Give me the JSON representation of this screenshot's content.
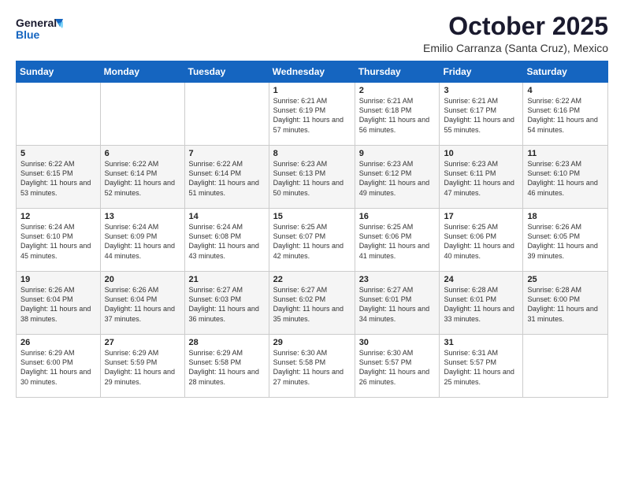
{
  "header": {
    "logo_line1": "General",
    "logo_line2": "Blue",
    "month_title": "October 2025",
    "subtitle": "Emilio Carranza (Santa Cruz), Mexico"
  },
  "weekdays": [
    "Sunday",
    "Monday",
    "Tuesday",
    "Wednesday",
    "Thursday",
    "Friday",
    "Saturday"
  ],
  "weeks": [
    [
      {
        "day": "",
        "sunrise": "",
        "sunset": "",
        "daylight": ""
      },
      {
        "day": "",
        "sunrise": "",
        "sunset": "",
        "daylight": ""
      },
      {
        "day": "",
        "sunrise": "",
        "sunset": "",
        "daylight": ""
      },
      {
        "day": "1",
        "sunrise": "Sunrise: 6:21 AM",
        "sunset": "Sunset: 6:19 PM",
        "daylight": "Daylight: 11 hours and 57 minutes."
      },
      {
        "day": "2",
        "sunrise": "Sunrise: 6:21 AM",
        "sunset": "Sunset: 6:18 PM",
        "daylight": "Daylight: 11 hours and 56 minutes."
      },
      {
        "day": "3",
        "sunrise": "Sunrise: 6:21 AM",
        "sunset": "Sunset: 6:17 PM",
        "daylight": "Daylight: 11 hours and 55 minutes."
      },
      {
        "day": "4",
        "sunrise": "Sunrise: 6:22 AM",
        "sunset": "Sunset: 6:16 PM",
        "daylight": "Daylight: 11 hours and 54 minutes."
      }
    ],
    [
      {
        "day": "5",
        "sunrise": "Sunrise: 6:22 AM",
        "sunset": "Sunset: 6:15 PM",
        "daylight": "Daylight: 11 hours and 53 minutes."
      },
      {
        "day": "6",
        "sunrise": "Sunrise: 6:22 AM",
        "sunset": "Sunset: 6:14 PM",
        "daylight": "Daylight: 11 hours and 52 minutes."
      },
      {
        "day": "7",
        "sunrise": "Sunrise: 6:22 AM",
        "sunset": "Sunset: 6:14 PM",
        "daylight": "Daylight: 11 hours and 51 minutes."
      },
      {
        "day": "8",
        "sunrise": "Sunrise: 6:23 AM",
        "sunset": "Sunset: 6:13 PM",
        "daylight": "Daylight: 11 hours and 50 minutes."
      },
      {
        "day": "9",
        "sunrise": "Sunrise: 6:23 AM",
        "sunset": "Sunset: 6:12 PM",
        "daylight": "Daylight: 11 hours and 49 minutes."
      },
      {
        "day": "10",
        "sunrise": "Sunrise: 6:23 AM",
        "sunset": "Sunset: 6:11 PM",
        "daylight": "Daylight: 11 hours and 47 minutes."
      },
      {
        "day": "11",
        "sunrise": "Sunrise: 6:23 AM",
        "sunset": "Sunset: 6:10 PM",
        "daylight": "Daylight: 11 hours and 46 minutes."
      }
    ],
    [
      {
        "day": "12",
        "sunrise": "Sunrise: 6:24 AM",
        "sunset": "Sunset: 6:10 PM",
        "daylight": "Daylight: 11 hours and 45 minutes."
      },
      {
        "day": "13",
        "sunrise": "Sunrise: 6:24 AM",
        "sunset": "Sunset: 6:09 PM",
        "daylight": "Daylight: 11 hours and 44 minutes."
      },
      {
        "day": "14",
        "sunrise": "Sunrise: 6:24 AM",
        "sunset": "Sunset: 6:08 PM",
        "daylight": "Daylight: 11 hours and 43 minutes."
      },
      {
        "day": "15",
        "sunrise": "Sunrise: 6:25 AM",
        "sunset": "Sunset: 6:07 PM",
        "daylight": "Daylight: 11 hours and 42 minutes."
      },
      {
        "day": "16",
        "sunrise": "Sunrise: 6:25 AM",
        "sunset": "Sunset: 6:06 PM",
        "daylight": "Daylight: 11 hours and 41 minutes."
      },
      {
        "day": "17",
        "sunrise": "Sunrise: 6:25 AM",
        "sunset": "Sunset: 6:06 PM",
        "daylight": "Daylight: 11 hours and 40 minutes."
      },
      {
        "day": "18",
        "sunrise": "Sunrise: 6:26 AM",
        "sunset": "Sunset: 6:05 PM",
        "daylight": "Daylight: 11 hours and 39 minutes."
      }
    ],
    [
      {
        "day": "19",
        "sunrise": "Sunrise: 6:26 AM",
        "sunset": "Sunset: 6:04 PM",
        "daylight": "Daylight: 11 hours and 38 minutes."
      },
      {
        "day": "20",
        "sunrise": "Sunrise: 6:26 AM",
        "sunset": "Sunset: 6:04 PM",
        "daylight": "Daylight: 11 hours and 37 minutes."
      },
      {
        "day": "21",
        "sunrise": "Sunrise: 6:27 AM",
        "sunset": "Sunset: 6:03 PM",
        "daylight": "Daylight: 11 hours and 36 minutes."
      },
      {
        "day": "22",
        "sunrise": "Sunrise: 6:27 AM",
        "sunset": "Sunset: 6:02 PM",
        "daylight": "Daylight: 11 hours and 35 minutes."
      },
      {
        "day": "23",
        "sunrise": "Sunrise: 6:27 AM",
        "sunset": "Sunset: 6:01 PM",
        "daylight": "Daylight: 11 hours and 34 minutes."
      },
      {
        "day": "24",
        "sunrise": "Sunrise: 6:28 AM",
        "sunset": "Sunset: 6:01 PM",
        "daylight": "Daylight: 11 hours and 33 minutes."
      },
      {
        "day": "25",
        "sunrise": "Sunrise: 6:28 AM",
        "sunset": "Sunset: 6:00 PM",
        "daylight": "Daylight: 11 hours and 31 minutes."
      }
    ],
    [
      {
        "day": "26",
        "sunrise": "Sunrise: 6:29 AM",
        "sunset": "Sunset: 6:00 PM",
        "daylight": "Daylight: 11 hours and 30 minutes."
      },
      {
        "day": "27",
        "sunrise": "Sunrise: 6:29 AM",
        "sunset": "Sunset: 5:59 PM",
        "daylight": "Daylight: 11 hours and 29 minutes."
      },
      {
        "day": "28",
        "sunrise": "Sunrise: 6:29 AM",
        "sunset": "Sunset: 5:58 PM",
        "daylight": "Daylight: 11 hours and 28 minutes."
      },
      {
        "day": "29",
        "sunrise": "Sunrise: 6:30 AM",
        "sunset": "Sunset: 5:58 PM",
        "daylight": "Daylight: 11 hours and 27 minutes."
      },
      {
        "day": "30",
        "sunrise": "Sunrise: 6:30 AM",
        "sunset": "Sunset: 5:57 PM",
        "daylight": "Daylight: 11 hours and 26 minutes."
      },
      {
        "day": "31",
        "sunrise": "Sunrise: 6:31 AM",
        "sunset": "Sunset: 5:57 PM",
        "daylight": "Daylight: 11 hours and 25 minutes."
      },
      {
        "day": "",
        "sunrise": "",
        "sunset": "",
        "daylight": ""
      }
    ]
  ]
}
